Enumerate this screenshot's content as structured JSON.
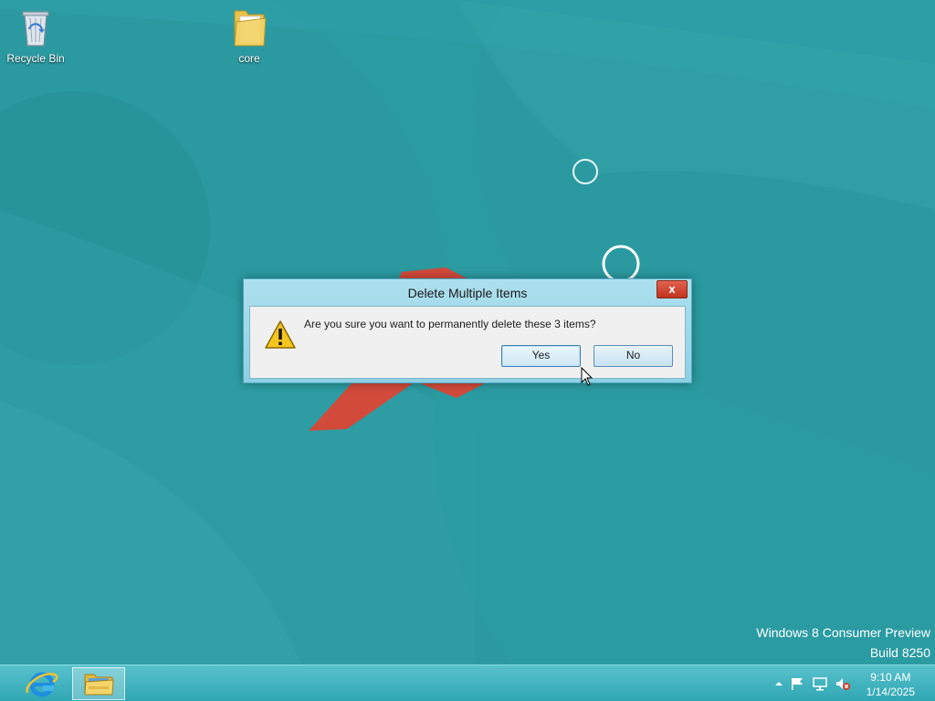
{
  "desktop": {
    "icons": [
      {
        "label": "Recycle Bin",
        "icon": "recycle-bin-icon"
      },
      {
        "label": "core",
        "icon": "folder-icon"
      }
    ],
    "watermark": {
      "line1": "Windows 8 Consumer Preview",
      "line2": "Build 8250"
    }
  },
  "dialog": {
    "title": "Delete Multiple Items",
    "close_label": "x",
    "icon": "warning-icon",
    "message": "Are you sure you want to permanently delete these 3 items?",
    "yes_label": "Yes",
    "no_label": "No"
  },
  "taskbar": {
    "pinned": [
      {
        "name": "Internet Explorer",
        "icon": "internet-explorer-icon"
      },
      {
        "name": "File Explorer",
        "icon": "file-explorer-icon"
      }
    ],
    "tray": {
      "icons": [
        "show-hidden-icons-chevron",
        "action-center-flag-icon",
        "network-icon",
        "volume-muted-icon"
      ],
      "time": "9:10 AM",
      "date": "1/14/2025"
    }
  },
  "colors": {
    "desktop_bg": "#2a9aa0",
    "taskbar": "#3fb2bd",
    "dialog_frame": "#9dd8e8",
    "close_button": "#c7402b"
  }
}
